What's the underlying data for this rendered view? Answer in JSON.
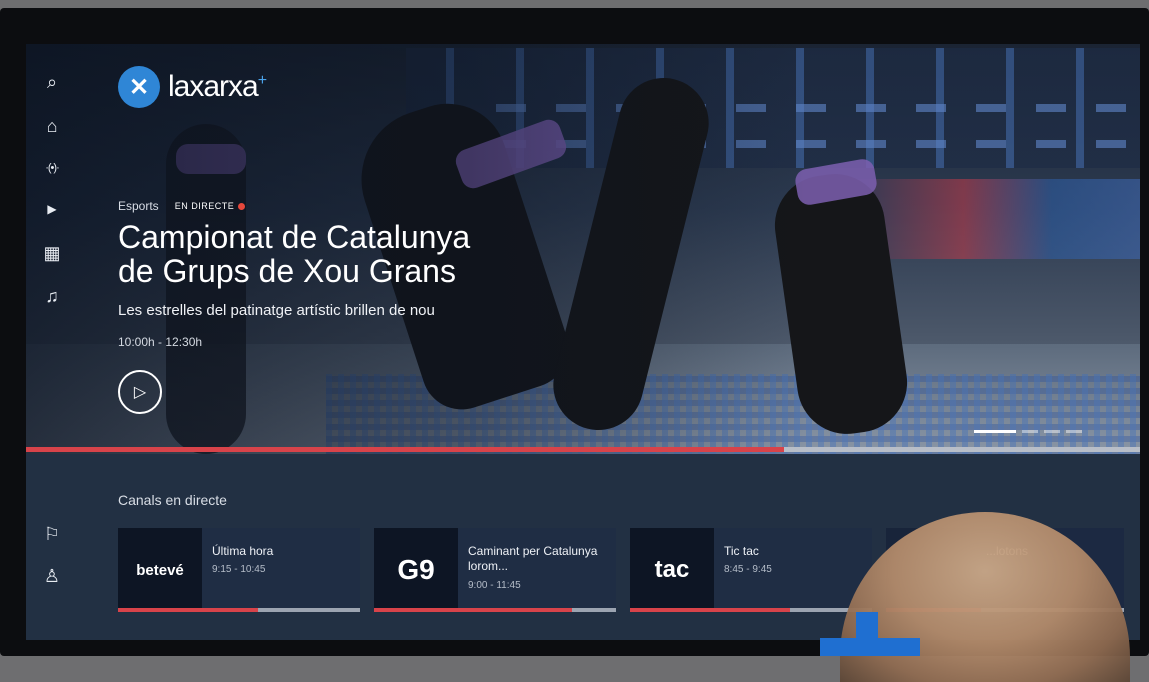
{
  "brand": {
    "logo_text": "laxarxa",
    "logo_suffix": "+",
    "accent_color": "#2f86d6",
    "live_color": "#e5473b"
  },
  "sidebar": {
    "items": [
      {
        "icon": "search-icon",
        "glyph": "⌕"
      },
      {
        "icon": "home-icon",
        "glyph": "⌂"
      },
      {
        "icon": "live-broadcast-icon",
        "glyph": "·(•)·"
      },
      {
        "icon": "video-icon",
        "glyph": "▶"
      },
      {
        "icon": "grid-icon",
        "glyph": "▦"
      },
      {
        "icon": "headphones-icon",
        "glyph": "♫"
      },
      {
        "icon": "bookmark-icon",
        "glyph": "⚐"
      },
      {
        "icon": "user-icon",
        "glyph": "♙"
      }
    ]
  },
  "hero": {
    "category": "Esports",
    "live_label": "EN DIRECTE",
    "title_line1": "Campionat de Catalunya",
    "title_line2": "de Grups de Xou Grans",
    "subtitle": "Les estrelles del patinatge artístic brillen de nou",
    "time": "10:00h - 12:30h",
    "play_glyph": "▷",
    "progress": 0.68,
    "carousel_count": 4,
    "carousel_active": 0
  },
  "live_channels": {
    "title": "Canals en directe",
    "cards": [
      {
        "logo": "betevé",
        "name": "Última hora",
        "time": "9:15 - 10:45",
        "progress": 0.58
      },
      {
        "logo": "G9",
        "name": "Caminant per Catalunya lorom...",
        "time": "9:00 - 11:45",
        "progress": 0.82
      },
      {
        "logo": "tac",
        "name": "Tic tac",
        "time": "8:45 - 9:45",
        "progress": 0.66
      },
      {
        "logo": "",
        "name": "...lotons",
        "time": "",
        "progress": 0.4
      }
    ]
  }
}
